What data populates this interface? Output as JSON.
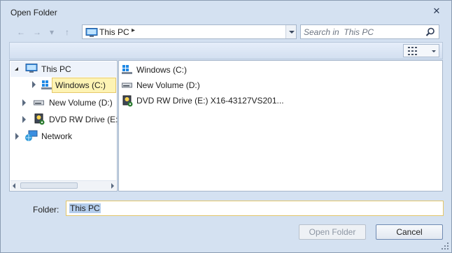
{
  "window": {
    "title": "Open Folder",
    "close_glyph": "✕"
  },
  "nav": {
    "back_glyph": "←",
    "forward_glyph": "→",
    "recent_glyph": "▾",
    "up_glyph": "↑"
  },
  "address": {
    "crumb": "This PC",
    "arrow_glyph": "▸"
  },
  "search": {
    "placeholder": "Search in  This PC"
  },
  "tree": {
    "items": [
      {
        "label": "This PC",
        "icon": "computer-icon",
        "expanded": true
      },
      {
        "label": "Windows (C:)",
        "icon": "system-drive-icon",
        "selected": true
      },
      {
        "label": "New Volume (D:)",
        "icon": "drive-icon"
      },
      {
        "label": "DVD RW Drive (E:)",
        "icon": "dvd-drive-icon"
      },
      {
        "label": "Network",
        "icon": "network-icon"
      }
    ]
  },
  "files": [
    {
      "label": "Windows (C:)",
      "icon": "system-drive-icon"
    },
    {
      "label": "New Volume (D:)",
      "icon": "drive-icon"
    },
    {
      "label": "DVD RW Drive (E:) X16-43127VS201...",
      "icon": "dvd-drive-icon"
    }
  ],
  "folder": {
    "label": "Folder:",
    "value": "This PC"
  },
  "buttons": {
    "open": "Open Folder",
    "cancel": "Cancel"
  },
  "colors": {
    "selection": "#fdf3b4",
    "frame": "#d4e1f1",
    "accent": "#b4cdec"
  }
}
